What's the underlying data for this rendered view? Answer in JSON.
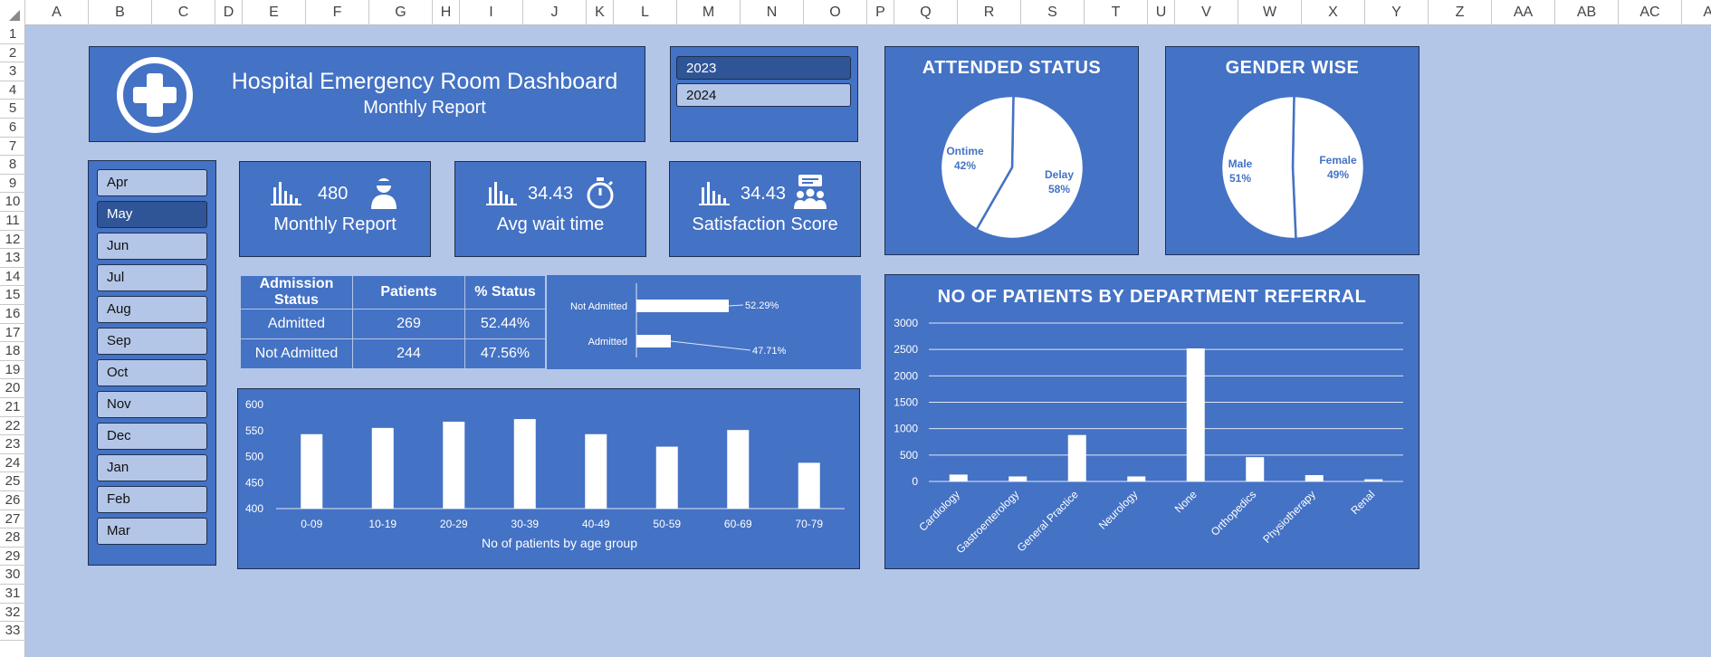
{
  "spreadsheet": {
    "columns": [
      "A",
      "B",
      "C",
      "D",
      "E",
      "F",
      "G",
      "H",
      "I",
      "J",
      "K",
      "L",
      "M",
      "N",
      "O",
      "P",
      "Q",
      "R",
      "S",
      "T",
      "U",
      "V",
      "W",
      "X",
      "Y",
      "Z",
      "AA",
      "AB",
      "AC",
      "AD"
    ],
    "rows": [
      "1",
      "2",
      "3",
      "4",
      "5",
      "6",
      "7",
      "8",
      "9",
      "10",
      "11",
      "12",
      "13",
      "14",
      "15",
      "16",
      "17",
      "18",
      "19",
      "20",
      "21",
      "22",
      "23",
      "24",
      "25",
      "26",
      "27",
      "28",
      "29",
      "30",
      "31",
      "32",
      "33"
    ]
  },
  "header": {
    "title": "Hospital Emergency Room Dashboard",
    "subtitle": "Monthly Report",
    "icon": "medical-cross-icon"
  },
  "year_slicer": {
    "items": [
      {
        "label": "2023",
        "selected": true
      },
      {
        "label": "2024",
        "selected": false
      }
    ]
  },
  "month_slicer": {
    "items": [
      {
        "label": "Apr",
        "selected": false
      },
      {
        "label": "May",
        "selected": true
      },
      {
        "label": "Jun",
        "selected": false
      },
      {
        "label": "Jul",
        "selected": false
      },
      {
        "label": "Aug",
        "selected": false
      },
      {
        "label": "Sep",
        "selected": false
      },
      {
        "label": "Oct",
        "selected": false
      },
      {
        "label": "Nov",
        "selected": false
      },
      {
        "label": "Dec",
        "selected": false
      },
      {
        "label": "Jan",
        "selected": false
      },
      {
        "label": "Feb",
        "selected": false
      },
      {
        "label": "Mar",
        "selected": false
      }
    ]
  },
  "kpis": [
    {
      "value": "480",
      "label": "Monthly Report",
      "icon": "doctor-icon"
    },
    {
      "value": "34.43",
      "label": "Avg wait time",
      "icon": "stopwatch-icon"
    },
    {
      "value": "34.43",
      "label": "Satisfaction Score",
      "icon": "group-feedback-icon"
    }
  ],
  "admission_table": {
    "headers": [
      "Admission Status",
      "Patients",
      "% Status"
    ],
    "rows": [
      [
        "Admitted",
        "269",
        "52.44%"
      ],
      [
        "Not Admitted",
        "244",
        "47.56%"
      ]
    ]
  },
  "colors": {
    "background": "#b4c6e7",
    "panel": "#4472c4",
    "selected": "#2f5597",
    "text": "#ffffff"
  },
  "chart_data": [
    {
      "type": "bar",
      "orientation": "horizontal",
      "categories": [
        "Not Admitted",
        "Admitted"
      ],
      "values": [
        52.29,
        47.71
      ],
      "value_labels": [
        "52.29%",
        "47.71%"
      ]
    },
    {
      "type": "bar",
      "categories": [
        "0-09",
        "10-19",
        "20-29",
        "30-39",
        "40-49",
        "50-59",
        "60-69",
        "70-79"
      ],
      "values": [
        543,
        555,
        567,
        572,
        543,
        519,
        551,
        488
      ],
      "xlabel": "No of patients by age group",
      "ylim": [
        400,
        600
      ],
      "yticks": [
        "400",
        "450",
        "500",
        "550",
        "600"
      ]
    },
    {
      "type": "pie",
      "title": "ATTENDED STATUS",
      "labels": [
        "Delay",
        "Ontime"
      ],
      "values": [
        58,
        42
      ],
      "value_labels": [
        "58%",
        "42%"
      ]
    },
    {
      "type": "pie",
      "title": "GENDER WISE",
      "labels": [
        "Female",
        "Male"
      ],
      "values": [
        49,
        51
      ],
      "value_labels": [
        "49%",
        "51%"
      ]
    },
    {
      "type": "bar",
      "title": "NO OF PATIENTS BY DEPARTMENT REFERRAL",
      "categories": [
        "Cardiology",
        "Gastroenterology",
        "General Practice",
        "Neurology",
        "None",
        "Orthopedics",
        "Physiotherapy",
        "Renal"
      ],
      "values": [
        130,
        95,
        880,
        95,
        2520,
        460,
        120,
        40
      ],
      "ylim": [
        0,
        3000
      ],
      "yticks": [
        "0",
        "500",
        "1000",
        "1500",
        "2000",
        "2500",
        "3000"
      ],
      "grid": true
    }
  ]
}
